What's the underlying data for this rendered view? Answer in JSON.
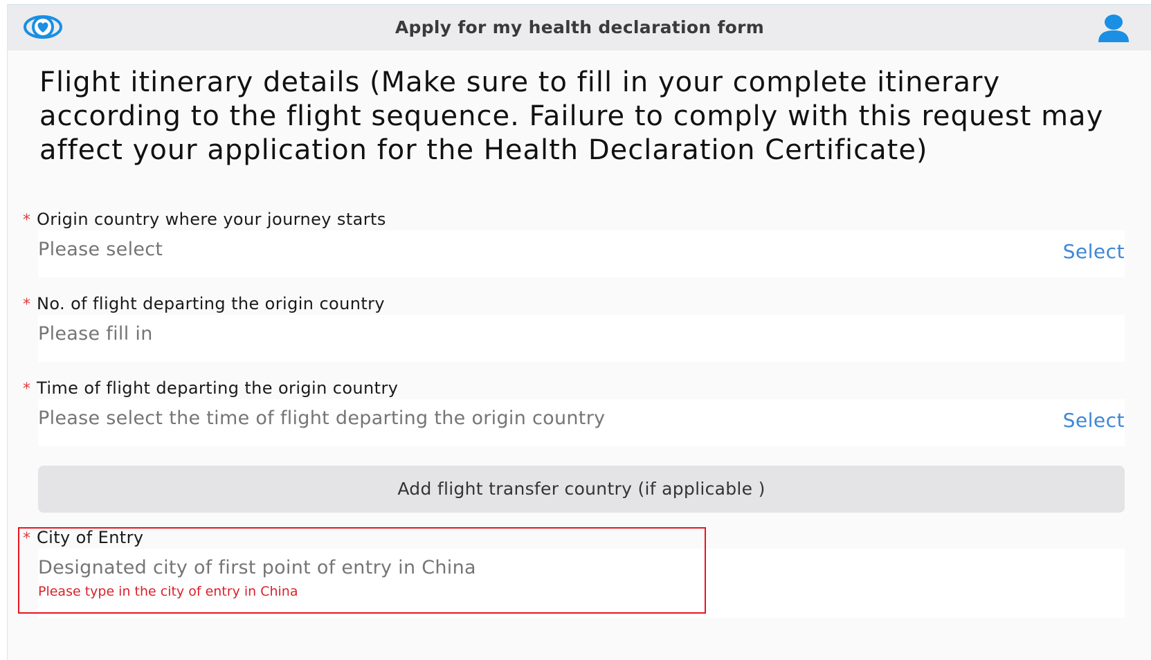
{
  "header": {
    "title": "Apply for my health declaration form",
    "logo_icon": "heart-shield-logo-icon",
    "user_icon": "user-profile-icon",
    "accent_color": "#1a8fe3"
  },
  "section": {
    "title": "Flight itinerary details (Make sure to fill in your complete itinerary according to the flight sequence. Failure to comply with this request may affect your application for the Health Declaration Certificate)"
  },
  "fields": {
    "origin_country": {
      "required_mark": "*",
      "label": "Origin country where your journey starts",
      "placeholder": "Please select",
      "action": "Select"
    },
    "flight_no": {
      "required_mark": "*",
      "label": "No. of flight departing the origin country",
      "placeholder": "Please fill in"
    },
    "flight_time": {
      "required_mark": "*",
      "label": "Time of flight departing the origin country",
      "placeholder": "Please select the time of flight departing the origin country",
      "action": "Select"
    },
    "city_of_entry": {
      "required_mark": "*",
      "label": "City of Entry",
      "placeholder": "Designated city of first point of entry in China",
      "error": "Please type in the city of entry in China"
    }
  },
  "add_transfer_button": "Add flight transfer country (if applicable )",
  "colors": {
    "link": "#3d87d6",
    "required": "#e03b3b",
    "error": "#d8222a",
    "highlight_border": "#e8141d"
  }
}
